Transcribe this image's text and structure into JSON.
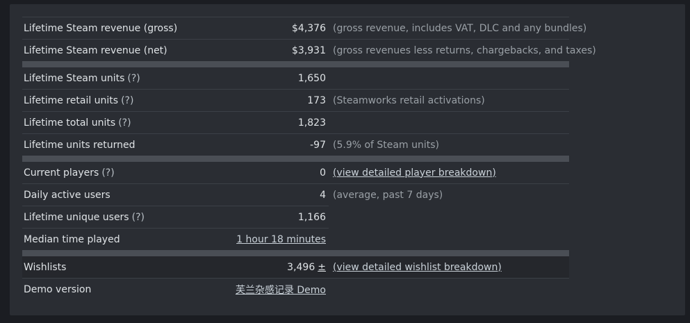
{
  "revenue": {
    "gross": {
      "label": "Lifetime Steam revenue (gross)",
      "value": "$4,376",
      "note": "(gross revenue, includes VAT, DLC and any bundles)"
    },
    "net": {
      "label": "Lifetime Steam revenue (net)",
      "value": "$3,931",
      "note": "(gross revenues less returns, chargebacks, and taxes)"
    }
  },
  "units": {
    "steam": {
      "label": "Lifetime Steam units",
      "help": "(?)",
      "value": "1,650"
    },
    "retail": {
      "label": "Lifetime retail units",
      "help": "(?)",
      "value": "173",
      "note": "(Steamworks retail activations)"
    },
    "total": {
      "label": "Lifetime total units",
      "help": "(?)",
      "value": "1,823"
    },
    "returned": {
      "label": "Lifetime units returned",
      "value": "-97",
      "note": "(5.9% of Steam units)"
    }
  },
  "players": {
    "current": {
      "label": "Current players",
      "help": "(?)",
      "value": "0",
      "link": "(view detailed player breakdown)"
    },
    "daily": {
      "label": "Daily active users",
      "value": "4",
      "note": "(average, past 7 days)"
    },
    "unique": {
      "label": "Lifetime unique users",
      "help": "(?)",
      "value": "1,166"
    },
    "median": {
      "label": "Median time played",
      "value": "1 hour 18 minutes"
    }
  },
  "wishlists": {
    "label": "Wishlists",
    "value": "3,496",
    "plus": "±",
    "link": "(view detailed wishlist breakdown)"
  },
  "demo": {
    "label": "Demo version",
    "value": "芙兰杂感记录 Demo"
  }
}
